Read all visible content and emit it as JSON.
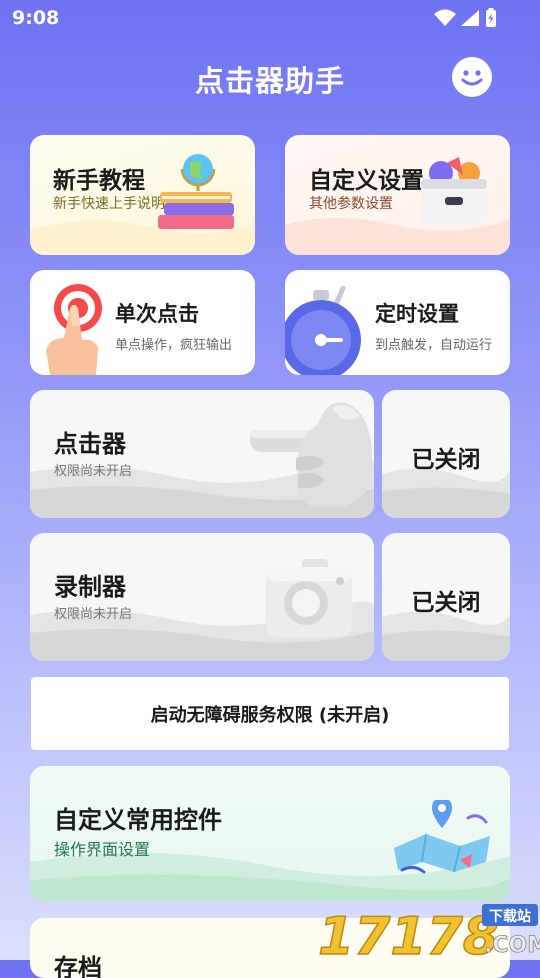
{
  "status_bar": {
    "time": "9:08"
  },
  "header": {
    "title": "点击器助手",
    "smile_icon": "smile-icon"
  },
  "cards": {
    "tutorial": {
      "title": "新手教程",
      "subtitle": "新手快速上手说明"
    },
    "custom_settings": {
      "title": "自定义设置",
      "subtitle": "其他参数设置"
    },
    "single_click": {
      "title": "单次点击",
      "subtitle": "单点操作，疯狂输出"
    },
    "timer": {
      "title": "定时设置",
      "subtitle": "到点触发，自动运行"
    },
    "clicker": {
      "title": "点击器",
      "subtitle": "权限尚未开启",
      "status": "已关闭"
    },
    "recorder": {
      "title": "录制器",
      "subtitle": "权限尚未开启",
      "status": "已关闭"
    },
    "accessibility": {
      "label": "启动无障碍服务权限 (未开启)"
    },
    "custom_widgets": {
      "title": "自定义常用控件",
      "subtitle": "操作界面设置"
    },
    "partial": {
      "title": "存档"
    }
  },
  "watermark": {
    "brand": "17178",
    "tag": "下载站",
    "suffix": ".COM"
  },
  "colors": {
    "accent": "#6f73f2",
    "green": "#1e7a4b",
    "gold": "#7a6a2b"
  }
}
